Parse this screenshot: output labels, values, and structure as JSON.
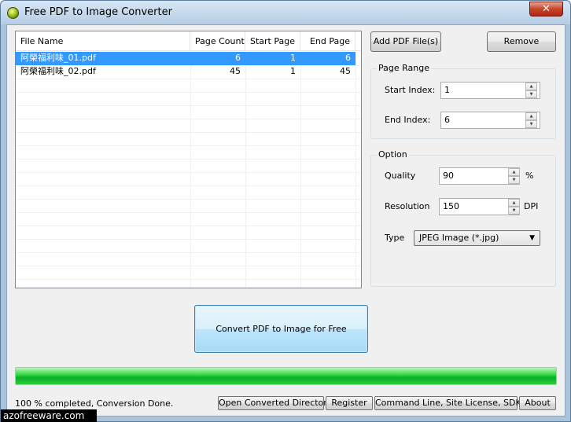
{
  "window": {
    "title": "Free PDF to Image Converter",
    "close_symbol": "✕"
  },
  "file_list": {
    "columns": [
      "File Name",
      "Page Count",
      "Start Page",
      "End Page"
    ],
    "rows": [
      {
        "file": "阿榮福利味_01.pdf",
        "page_count": "6",
        "start": "1",
        "end": "6",
        "selected": true
      },
      {
        "file": "阿榮福利味_02.pdf",
        "page_count": "45",
        "start": "1",
        "end": "45",
        "selected": false
      }
    ]
  },
  "buttons": {
    "add": "Add PDF File(s)",
    "remove": "Remove",
    "convert": "Convert PDF to Image for Free"
  },
  "page_range": {
    "group_label": "Page Range",
    "start_label": "Start Index:",
    "start_value": "1",
    "end_label": "End Index:",
    "end_value": "6"
  },
  "option": {
    "group_label": "Option",
    "quality_label": "Quality",
    "quality_value": "90",
    "quality_unit": "%",
    "resolution_label": "Resolution",
    "resolution_value": "150",
    "resolution_unit": "DPI",
    "type_label": "Type",
    "type_value": "JPEG Image (*.jpg)"
  },
  "progress": {
    "percent": 100,
    "color": "#06b025"
  },
  "status_text": "100 % completed, Conversion Done.",
  "bottom_buttons": {
    "open_dir": "Open Converted Directory",
    "register": "Register",
    "command_line": "Command Line, Site License, SDK",
    "about": "About"
  },
  "watermark": "azofreeware.com"
}
